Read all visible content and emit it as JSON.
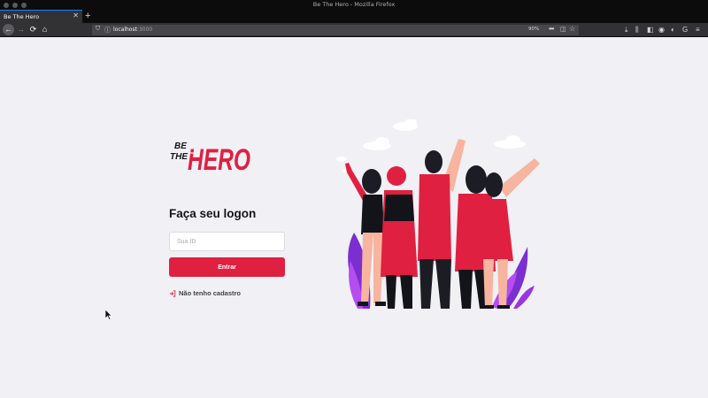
{
  "browser": {
    "window_title": "Be The Hero - Mozilla Firefox",
    "tab_title": "Be The Hero",
    "url_host": "localhost",
    "url_port": ":3000",
    "zoom": "90%",
    "icons": [
      "back-arrow-icon",
      "forward-arrow-icon",
      "reload-icon",
      "home-icon",
      "shield-icon",
      "info-icon",
      "more-icon",
      "pocket-icon",
      "star-icon",
      "download-icon",
      "library-icon",
      "sidebar-icon",
      "account-icon",
      "extension-icon",
      "menu-icon"
    ]
  },
  "logo": {
    "line1": "BE",
    "line2": "THE",
    "word": "HERO"
  },
  "login": {
    "heading": "Faça seu logon",
    "id_placeholder": "Sua ID",
    "id_value": "",
    "submit_label": "Entrar",
    "register_label": "Não tenho cadastro"
  },
  "colors": {
    "brand_red": "#e02041",
    "background": "#f0f0f5",
    "text_dark": "#13131a",
    "illustration_purple": "#7b2fd1"
  }
}
